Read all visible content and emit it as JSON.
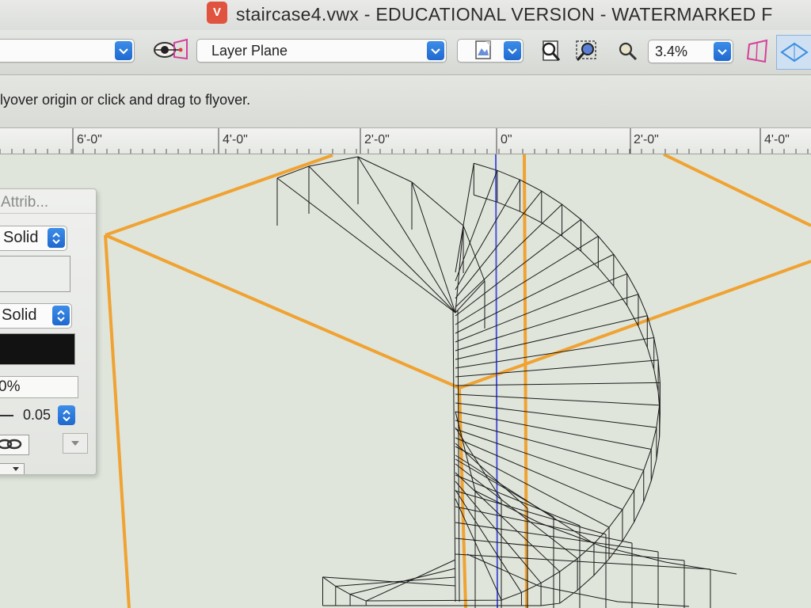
{
  "window": {
    "title": "staircase4.vwx - EDUCATIONAL VERSION - WATERMARKED F"
  },
  "toolbar": {
    "class_dropdown": "",
    "eye_icon": "flyover-eye-icon",
    "layer_plane": "Layer Plane",
    "render_icon": "render-mode-icon",
    "zoom_value": "3.4%"
  },
  "help_bar": {
    "message": "lyover origin or click and drag to flyover."
  },
  "ruler": {
    "labels": [
      "6'-0\"",
      "4'-0\"",
      "2'-0\"",
      "0\"",
      "2'-0\"",
      "4'-0\""
    ]
  },
  "attributes_palette": {
    "title": "Attrib...",
    "fill_style": "Solid",
    "pen_style": "Solid",
    "opacity": "0%",
    "line_thickness": "0.05"
  },
  "colors": {
    "accent_blue": "#1f69cf",
    "guide_orange": "#f0a232",
    "axis_blue": "#4a55d8",
    "wireframe": "#1a1a1a",
    "canvas_bg": "#dfe5da"
  }
}
